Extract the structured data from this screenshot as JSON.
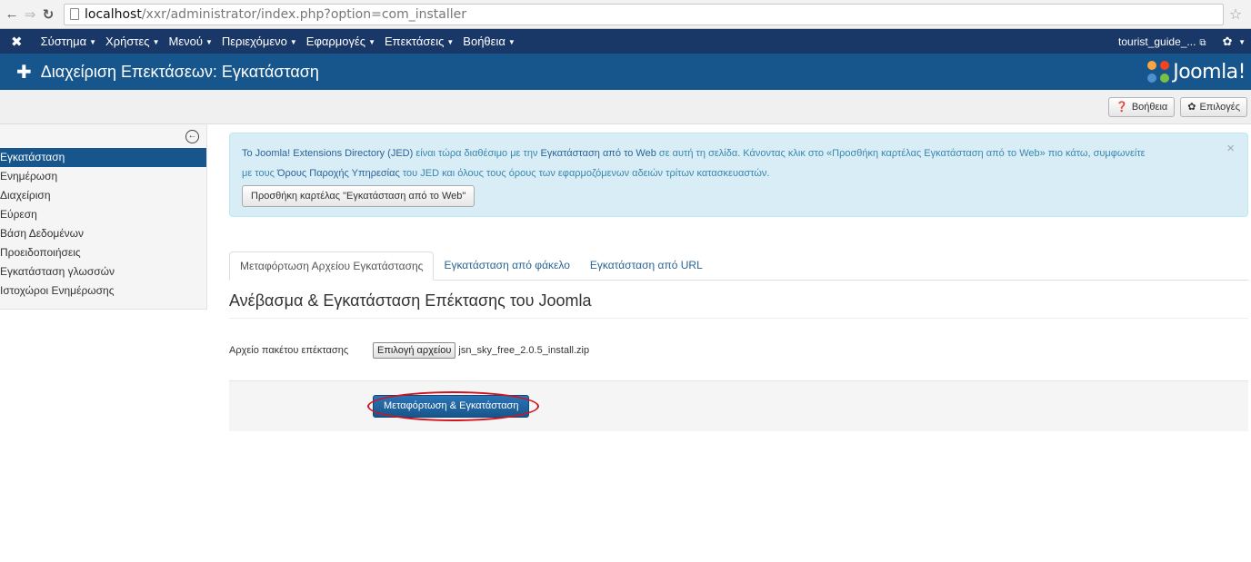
{
  "browser": {
    "url_host": "localhost",
    "url_path": "/xxr/administrator/index.php?option=com_installer"
  },
  "topnav": {
    "items": [
      "Σύστημα",
      "Χρήστες",
      "Μενού",
      "Περιεχόμενο",
      "Εφαρμογές",
      "Επεκτάσεις",
      "Βοήθεια"
    ],
    "user": "tourist_guide_..."
  },
  "header": {
    "title": "Διαχείριση Επεκτάσεων: Εγκατάσταση",
    "brand": "Joomla!"
  },
  "toolbar": {
    "help_label": "Βοήθεια",
    "options_label": "Επιλογές"
  },
  "sidebar": {
    "items": [
      {
        "label": "Εγκατάσταση",
        "active": true
      },
      {
        "label": "Ενημέρωση"
      },
      {
        "label": "Διαχείριση"
      },
      {
        "label": "Εύρεση"
      },
      {
        "label": "Βάση Δεδομένων"
      },
      {
        "label": "Προειδοποιήσεις"
      },
      {
        "label": "Εγκατάσταση γλωσσών"
      },
      {
        "label": "Ιστοχώροι Ενημέρωσης"
      }
    ]
  },
  "alert": {
    "link1": "Το Joomla! Extensions Directory (JED)",
    "text1": " είναι τώρα διαθέσιμο με την ",
    "link2": "Εγκατάσταση από το Web",
    "text2": " σε αυτή τη σελίδα.  Κάνοντας κλικ στο «Προσθήκη καρτέλας Εγκατάσταση από το Web» πιο κάτω, συμφωνείτε",
    "text3": "με τους ",
    "link3": "Όρους Παροχής Υπηρεσίας",
    "text4": " του JED και όλους τους όρους των εφαρμοζόμενων αδειών τρίτων κατασκευαστών.",
    "button": "Προσθήκη καρτέλας \"Εγκατάσταση από το Web\"",
    "close": "×"
  },
  "tabs": [
    {
      "label": "Μεταφόρτωση Αρχείου Εγκατάστασης",
      "active": true
    },
    {
      "label": "Εγκατάσταση από φάκελο"
    },
    {
      "label": "Εγκατάσταση από URL"
    }
  ],
  "section_title": "Ανέβασμα & Εγκατάσταση Επέκτασης του Joomla",
  "file_field": {
    "label": "Αρχείο πακέτου επέκτασης",
    "button": "Επιλογή αρχείου",
    "filename": "jsn_sky_free_2.0.5_install.zip"
  },
  "upload_button": "Μεταφόρτωση & Εγκατάσταση",
  "annotation_color": "#d0141f"
}
